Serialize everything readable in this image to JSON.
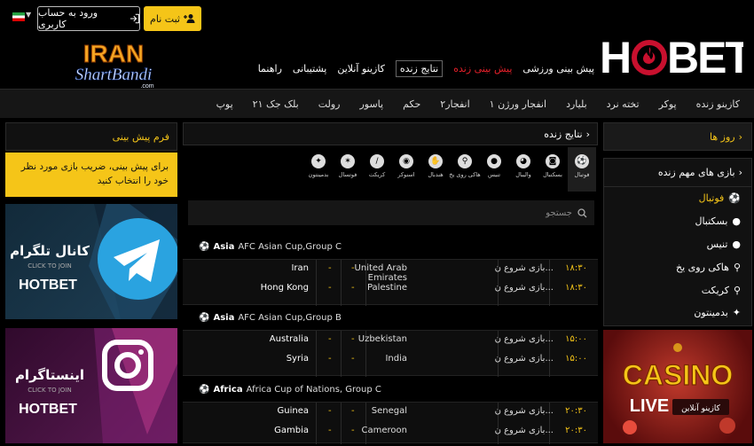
{
  "top": {
    "register_label": "ثبت نام",
    "login_label": "ورود به حساب کاربری"
  },
  "brand": {
    "name": "HOTBET",
    "partner_line1": "IRAN",
    "partner_line2": "ShartBandi",
    "partner_line3": ".com"
  },
  "mainnav": [
    {
      "label": "پیش بینی ورزشی",
      "style": "normal"
    },
    {
      "label": "پیش بینی زنده",
      "style": "red"
    },
    {
      "label": "نتایج زنده",
      "style": "boxed"
    },
    {
      "label": "کازینو آنلاین",
      "style": "normal"
    },
    {
      "label": "پشتیبانی",
      "style": "normal"
    },
    {
      "label": "راهنما",
      "style": "normal"
    }
  ],
  "subnav": [
    "کازینو زنده",
    "پوکر",
    "تخته نرد",
    "بلیارد",
    "انفجار ورژن ۱",
    "انفجار۲",
    "حکم",
    "پاسور",
    "رولت",
    "بلک جک ۲۱",
    "پوپ"
  ],
  "right": {
    "days_label": "روز ها",
    "live_title": "بازی های مهم زنده",
    "sports": [
      "فوتبال",
      "بسکتبال",
      "تنیس",
      "هاکی روی یخ",
      "کریکت",
      "بدمینتون"
    ],
    "casino_text": "CASINO",
    "casino_live": "LIVE",
    "casino_fa": "کازینو آنلاین"
  },
  "left": {
    "form_title": "فرم پیش بینی",
    "note": "برای پیش بینی، ضریب بازی مورد نظر خود را انتخاب کنید",
    "telegram_title": "کانال تلگرام",
    "telegram_sub": "CLICK TO JOIN",
    "insta_title": "اینستاگرام",
    "insta_sub": "CLICK TO JOIN",
    "banner_brand": "HOTBET"
  },
  "center": {
    "title": "نتایج زنده",
    "search_placeholder": "جستجو",
    "sport_tabs": [
      "فوتبال",
      "بسکتبال",
      "والیبال",
      "تنیس",
      "هاکی روی یخ",
      "هندبال",
      "اسنوکر",
      "کریکت",
      "فوتسال",
      "بدمینتون"
    ],
    "groups": [
      {
        "region": "Asia",
        "name": "AFC Asian Cup,Group C",
        "matches": [
          {
            "time": "۱۸:۳۰",
            "status": "بازی شروع ن...",
            "away": "United Arab Emirates",
            "home": "Iran",
            "s1": "-",
            "s2": "-"
          },
          {
            "time": "۱۸:۳۰",
            "status": "بازی شروع ن...",
            "away": "Palestine",
            "home": "Hong Kong",
            "s1": "-",
            "s2": "-"
          }
        ]
      },
      {
        "region": "Asia",
        "name": "AFC Asian Cup,Group B",
        "matches": [
          {
            "time": "۱۵:۰۰",
            "status": "بازی شروع ن...",
            "away": "Uzbekistan",
            "home": "Australia",
            "s1": "-",
            "s2": "-"
          },
          {
            "time": "۱۵:۰۰",
            "status": "بازی شروع ن...",
            "away": "India",
            "home": "Syria",
            "s1": "-",
            "s2": "-"
          }
        ]
      },
      {
        "region": "Africa",
        "name": "Africa Cup of Nations, Group C",
        "matches": [
          {
            "time": "۲۰:۳۰",
            "status": "بازی شروع ن...",
            "away": "Senegal",
            "home": "Guinea",
            "s1": "-",
            "s2": "-"
          },
          {
            "time": "۲۰:۳۰",
            "status": "بازی شروع ن...",
            "away": "Cameroon",
            "home": "Gambia",
            "s1": "-",
            "s2": "-"
          }
        ]
      }
    ]
  }
}
